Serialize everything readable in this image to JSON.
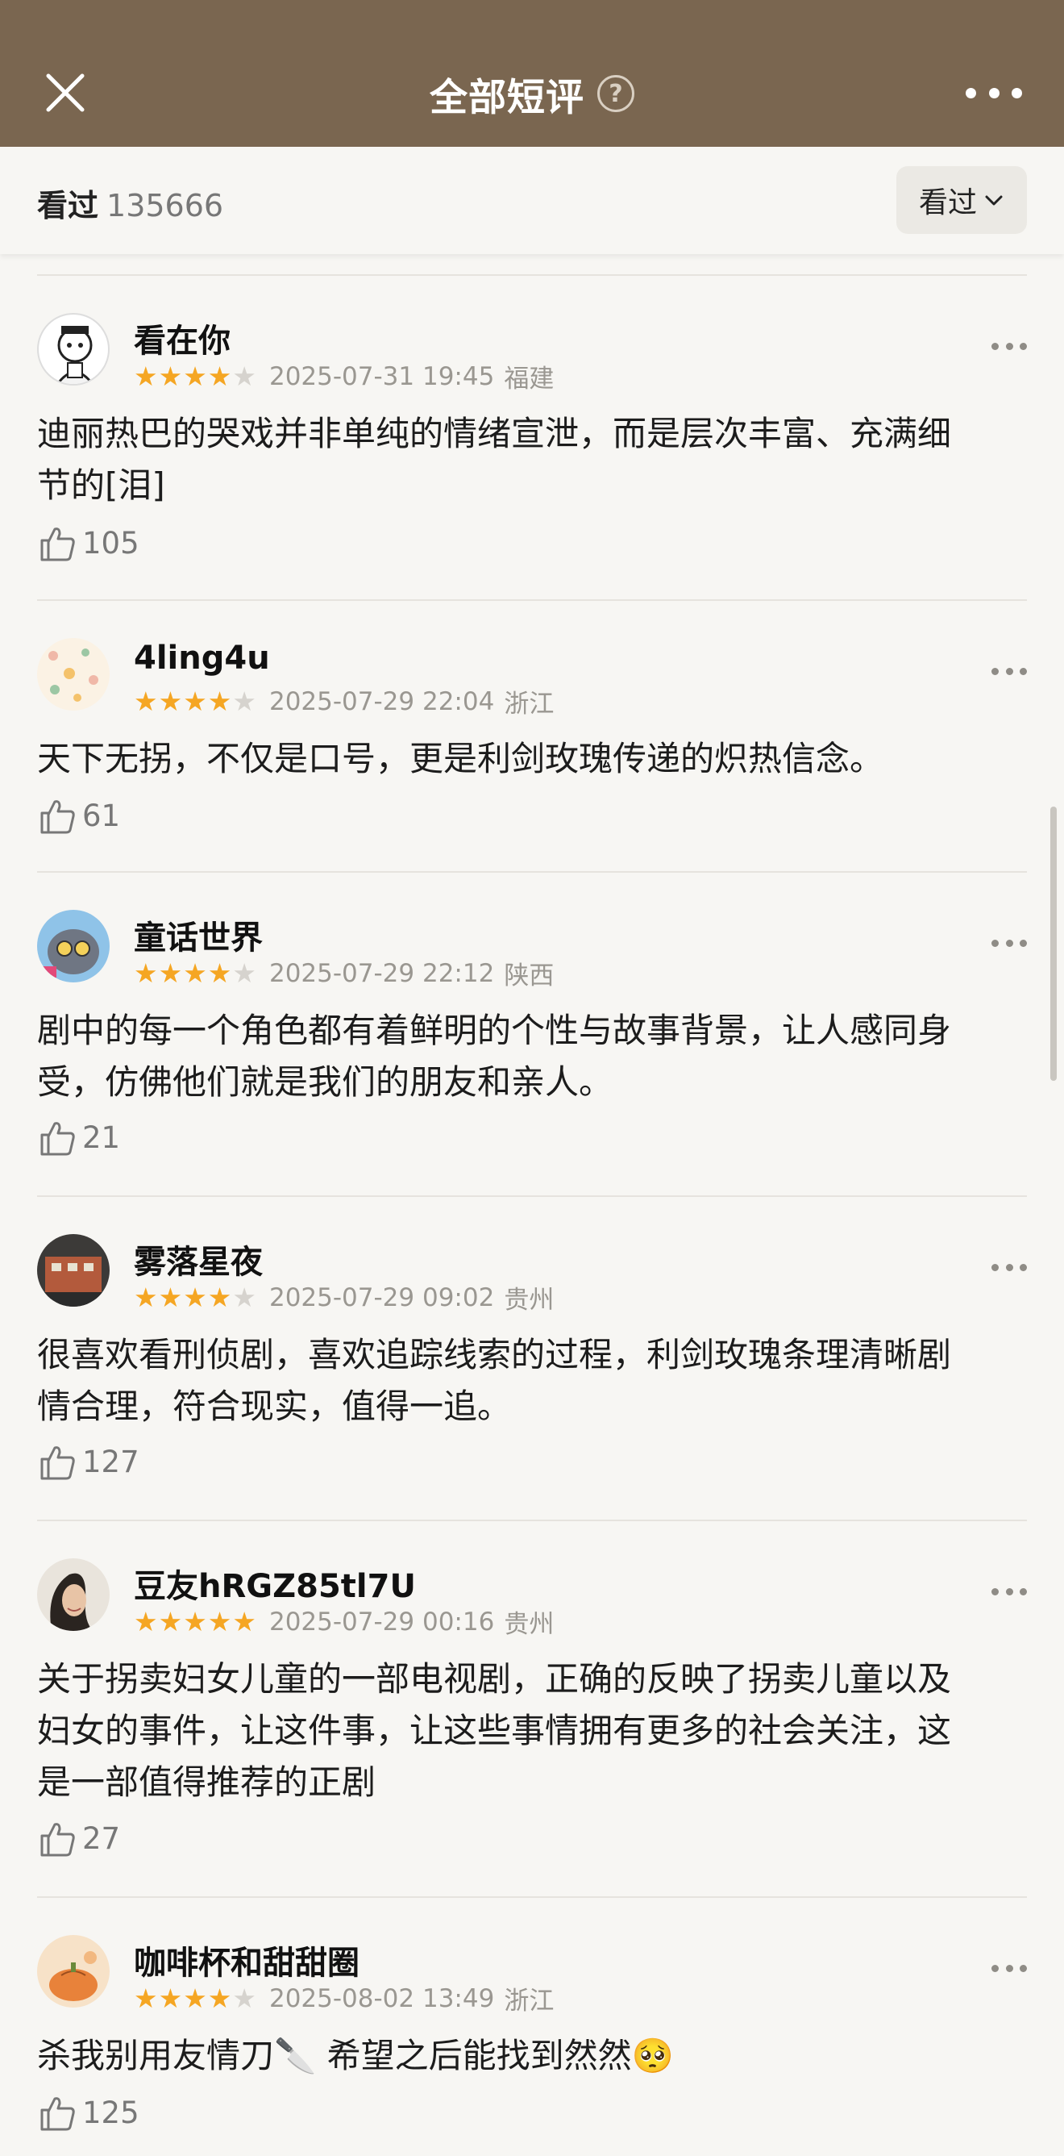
{
  "header": {
    "title": "全部短评",
    "help_icon": "question-circle-icon",
    "close_icon": "close-icon",
    "more_icon": "more-horizontal-icon"
  },
  "filter": {
    "label": "看过",
    "count": "135666",
    "dropdown_label": "看过"
  },
  "colors": {
    "header_bg": "#7a6650",
    "star_on": "#f5a623",
    "star_off": "#d6d3ce"
  },
  "reviews": [
    {
      "name": "看在你",
      "rating": 4,
      "date": "2025-07-31 19:45",
      "location": "福建",
      "lines": [
        "迪丽热巴的哭戏并非单纯的情绪宣泄，而是层次丰富、充满细",
        "节的[泪]"
      ],
      "likes": "105"
    },
    {
      "name": "4ling4u",
      "rating": 4,
      "date": "2025-07-29 22:04",
      "location": "浙江",
      "lines": [
        "天下无拐，不仅是口号，更是利剑玫瑰传递的炽热信念。"
      ],
      "likes": "61"
    },
    {
      "name": "童话世界",
      "rating": 4,
      "date": "2025-07-29 22:12",
      "location": "陕西",
      "lines": [
        "剧中的每一个角色都有着鲜明的个性与故事背景，让人感同身",
        "受，仿佛他们就是我们的朋友和亲人。"
      ],
      "likes": "21"
    },
    {
      "name": "雾落星夜",
      "rating": 4,
      "date": "2025-07-29 09:02",
      "location": "贵州",
      "lines": [
        "很喜欢看刑侦剧，喜欢追踪线索的过程，利剑玫瑰条理清晰剧",
        "情合理，符合现实，值得一追。"
      ],
      "likes": "127"
    },
    {
      "name": "豆友hRGZ85tl7U",
      "rating": 5,
      "date": "2025-07-29 00:16",
      "location": "贵州",
      "lines": [
        "关于拐卖妇女儿童的一部电视剧，正确的反映了拐卖儿童以及",
        "妇女的事件，让这件事，让这些事情拥有更多的社会关注，这",
        "是一部值得推荐的正剧"
      ],
      "likes": "27"
    },
    {
      "name": "咖啡杯和甜甜圈",
      "rating": 4,
      "date": "2025-08-02 13:49",
      "location": "浙江",
      "lines": [
        "杀我别用友情刀🔪 希望之后能找到然然🥺"
      ],
      "likes": "125"
    }
  ]
}
